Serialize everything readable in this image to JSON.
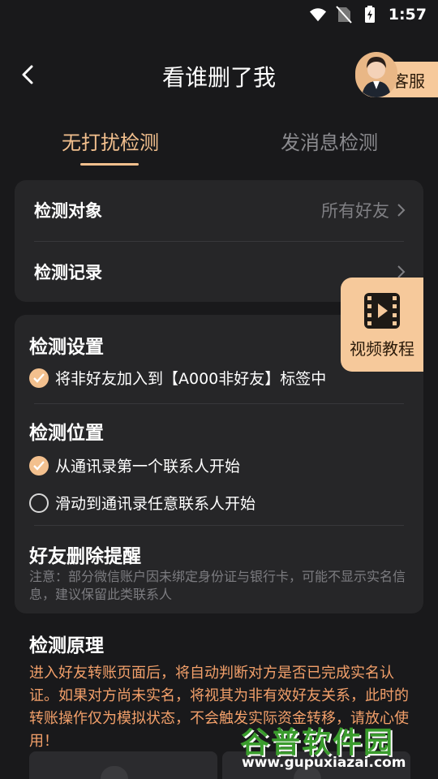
{
  "status_bar": {
    "time": "1:57"
  },
  "header": {
    "title": "看谁删了我",
    "service_label": "客服"
  },
  "tabs": [
    {
      "label": "无打扰检测",
      "active": true
    },
    {
      "label": "发消息检测",
      "active": false
    }
  ],
  "target_card": {
    "rows": [
      {
        "label": "检测对象",
        "value": "所有好友"
      },
      {
        "label": "检测记录",
        "value": ""
      }
    ]
  },
  "settings_card": {
    "settings_title": "检测设置",
    "settings_option": "将非好友加入到【A000非好友】标签中",
    "position_title": "检测位置",
    "position_options": [
      {
        "label": "从通讯录第一个联系人开始",
        "checked": true
      },
      {
        "label": "滑动到通讯录任意联系人开始",
        "checked": false
      }
    ],
    "reminder_title": "好友删除提醒",
    "reminder_note": "注意：部分微信账户因未绑定身份证与银行卡，可能不显示实名信息，建议保留此类联系人"
  },
  "video_tutorial": {
    "label": "视频教程"
  },
  "principle": {
    "title": "检测原理",
    "text": "进入好友转账页面后，将自动判断对方是否已完成实名认证。如果对方尚未实名，将视其为非有效好友关系，此时的转账操作仅为模拟状态，不会触发实际资金转移，请放心使用！"
  },
  "watermark": {
    "logo_text": "谷普软件园",
    "url": "www.gupuxiazai.com"
  },
  "colors": {
    "accent": "#f3c08e",
    "button_bg": "#f6c99b",
    "background": "#19191b",
    "card": "#262628",
    "principle_text": "#f3a06a"
  }
}
